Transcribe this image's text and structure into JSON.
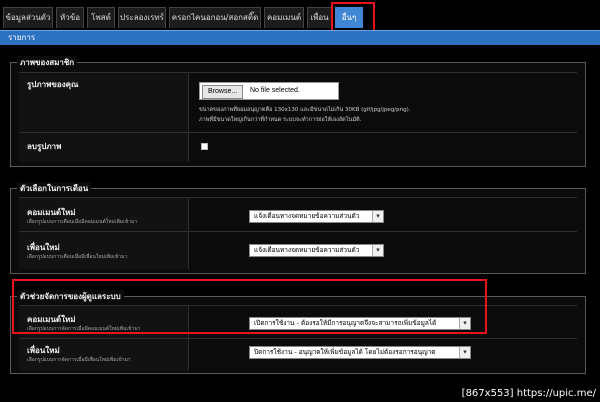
{
  "tabs": [
    {
      "label": "ข้อมูลส่วนตัว"
    },
    {
      "label": "หัวข้อ"
    },
    {
      "label": "โพสต์"
    },
    {
      "label": "ประลองเรทร์"
    },
    {
      "label": "ครอกไคนอกอน/สอกสติ๊ด"
    },
    {
      "label": "คอมเมนต์"
    },
    {
      "label": "เพื่อน"
    },
    {
      "label": "อื่นๆ"
    }
  ],
  "header": {
    "title": "รายการ"
  },
  "avatar_section": {
    "legend": "ภาพของสมาชิก",
    "photo_row": {
      "label": "รูปภาพของคุณ",
      "browse_label": "Browse...",
      "file_status": "No file selected.",
      "note_line1": "ขนาดของภาพที่ยอมอนุญาตคือ 130x130 และมีขนาดไม่เกิน 30KB (gif/jpg/jpeg/png).",
      "note_line2": "ภาพที่มีขนาดใหญ่เกินกว่าที่กำหนด ระบบจะทำการย่อให้เองอัตโนมัติ."
    },
    "delete_row": {
      "label": "ลบรูปภาพ",
      "checked": false
    }
  },
  "notify_section": {
    "legend": "ตัวเลือกในการเตือน",
    "rows": [
      {
        "title": "คอมเมนต์ใหม่",
        "desc": "เลือกรูปแบบการเตือนเมื่อมีคอมเมนต์ใหม่เพิ่มเข้ามา",
        "value": "แจ้งเตือนทางจดหมายข้อความส่วนตัว"
      },
      {
        "title": "เพื่อนใหม่",
        "desc": "เลือกรูปแบบการเตือนเมื่อมีเพื่อนใหม่เพิ่มเข้ามา",
        "value": "แจ้งเตือนทางจดหมายข้อความส่วนตัว"
      }
    ]
  },
  "manage_section": {
    "legend": "ตัวช่วยจัดการของผู้ดูแลระบบ",
    "rows": [
      {
        "title": "คอมเมนต์ใหม่",
        "desc": "เลือกรูปแบบการจัดการเมื่อมีคอมเมนต์ใหม่เพิ่มเข้ามา",
        "value": "เปิดการใช้งาน - ต้องรอให้มีการอนุญาตจึงจะสามารถเพิ่มข้อมูลได้"
      },
      {
        "title": "เพื่อนใหม่",
        "desc": "เลือกรูปแบบการจัดการเมื่อมีเพื่อนใหม่เพิ่มเข้ามา",
        "value": "ปิดการใช้งาน - อนุญาตให้เพิ่มข้อมูลได้ โดยไม่ต้องรอการอนุญาต"
      }
    ]
  },
  "watermark": "[867x553] https://upic.me/",
  "colors": {
    "accent": "#3f87d4",
    "header": "#2d71c2",
    "highlight": "#e8141b"
  }
}
